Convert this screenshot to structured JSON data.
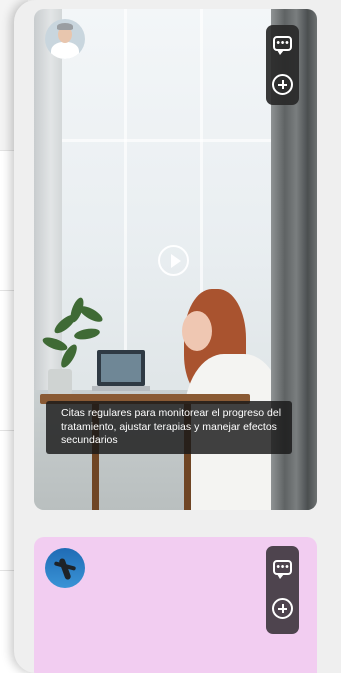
{
  "feed": {
    "items": [
      {
        "avatar_icon": "doctor-avatar",
        "caption": "Citas regulares para monitorear el progreso del tratamiento, ajustar terapias y manejar efectos secundarios",
        "media": "video",
        "actions": [
          "chat-icon",
          "add-icon"
        ]
      },
      {
        "avatar_icon": "yoga-avatar",
        "background_color": "#f2cdf1",
        "actions": [
          "chat-icon",
          "add-icon"
        ]
      }
    ]
  },
  "colors": {
    "sheet_bg": "#efefef",
    "pink_card": "#f2cdf1",
    "action_bar": "#282828",
    "caption_bg": "#181818"
  }
}
